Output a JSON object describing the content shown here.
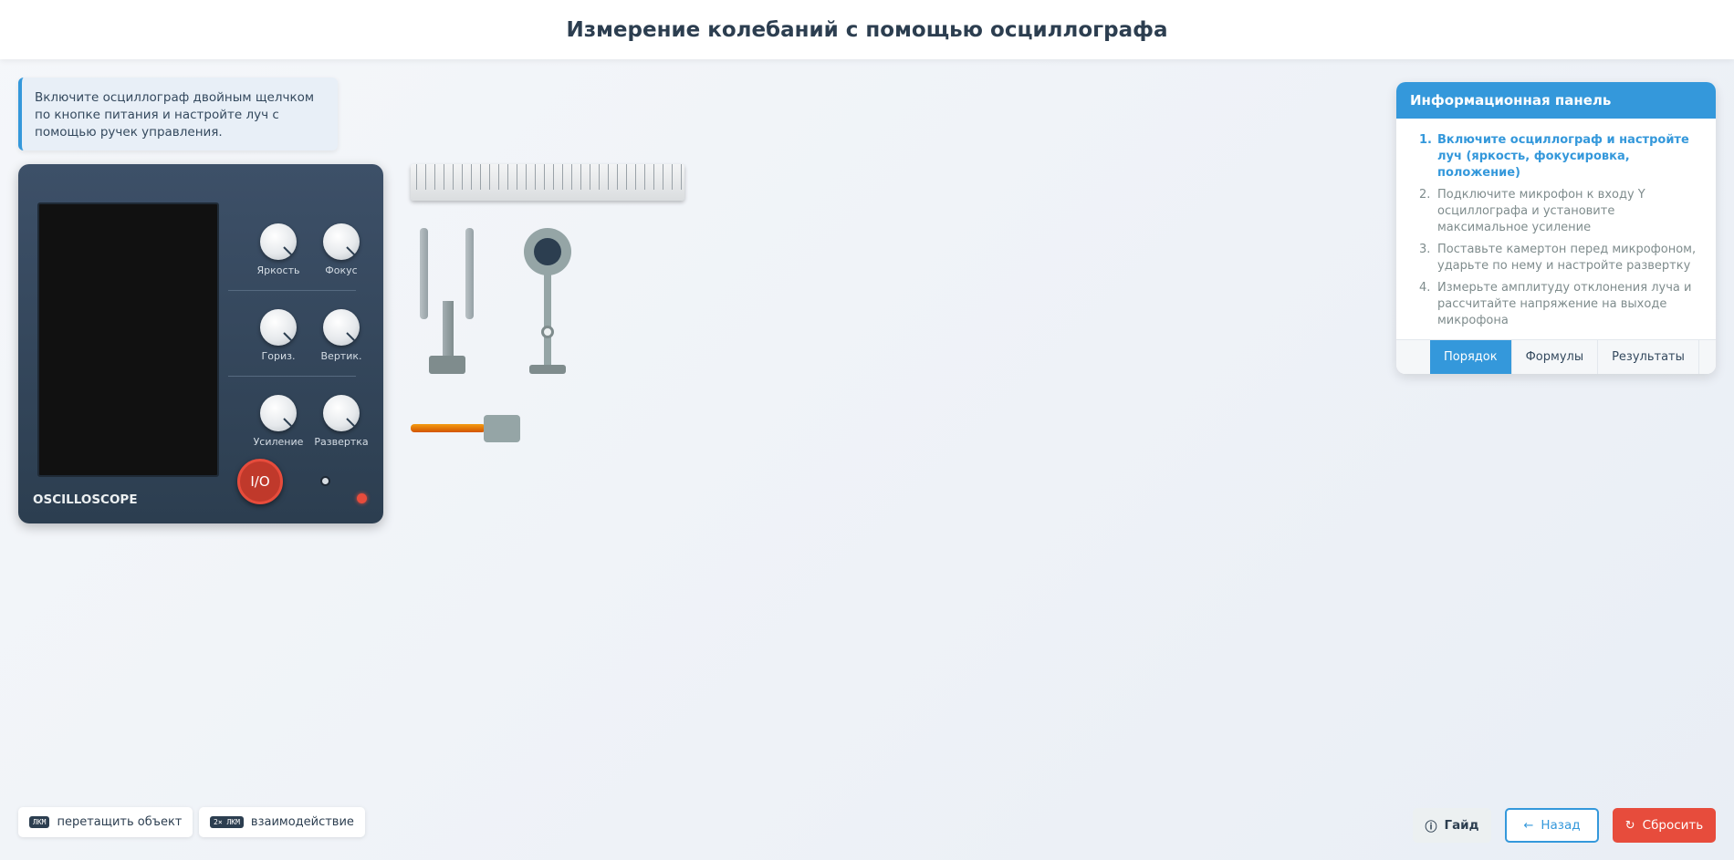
{
  "header": {
    "title": "Измерение колебаний с помощью осциллографа"
  },
  "hint": {
    "text": "Включите осциллограф двойным щелчком по кнопке питания и настройте луч с помощью ручек управления."
  },
  "oscilloscope": {
    "label": "OSCILLOSCOPE",
    "power_label": "I/O",
    "knobs": [
      "Яркость",
      "Фокус",
      "Гориз.",
      "Вертик.",
      "Усиление",
      "Развертка"
    ]
  },
  "panel": {
    "title": "Информационная панель",
    "steps": [
      {
        "num": "1.",
        "text": "Включите осциллограф и настройте луч (яркость, фокусировка, положение)"
      },
      {
        "num": "2.",
        "text": "Подключите микрофон к входу Y осциллографа и установите максимальное усиление"
      },
      {
        "num": "3.",
        "text": "Поставьте камертон перед микрофоном, ударьте по нему и настройте развертку"
      },
      {
        "num": "4.",
        "text": "Измерьте амплитуду отклонения луча и рассчитайте напряжение на выходе микрофона"
      }
    ],
    "tabs": [
      "Порядок",
      "Формулы",
      "Результаты"
    ],
    "active_tab": "Порядок"
  },
  "controls_hint": [
    {
      "key": "ЛКМ",
      "text": "перетащить объект"
    },
    {
      "key": "2× ЛКМ",
      "text": "взаимодействие"
    }
  ],
  "buttons": {
    "guide": "Гайд",
    "back": "Назад",
    "reset": "Сбросить"
  },
  "colors": {
    "accent": "#3498db",
    "danger": "#e74c3c",
    "dark": "#2c3e50"
  }
}
